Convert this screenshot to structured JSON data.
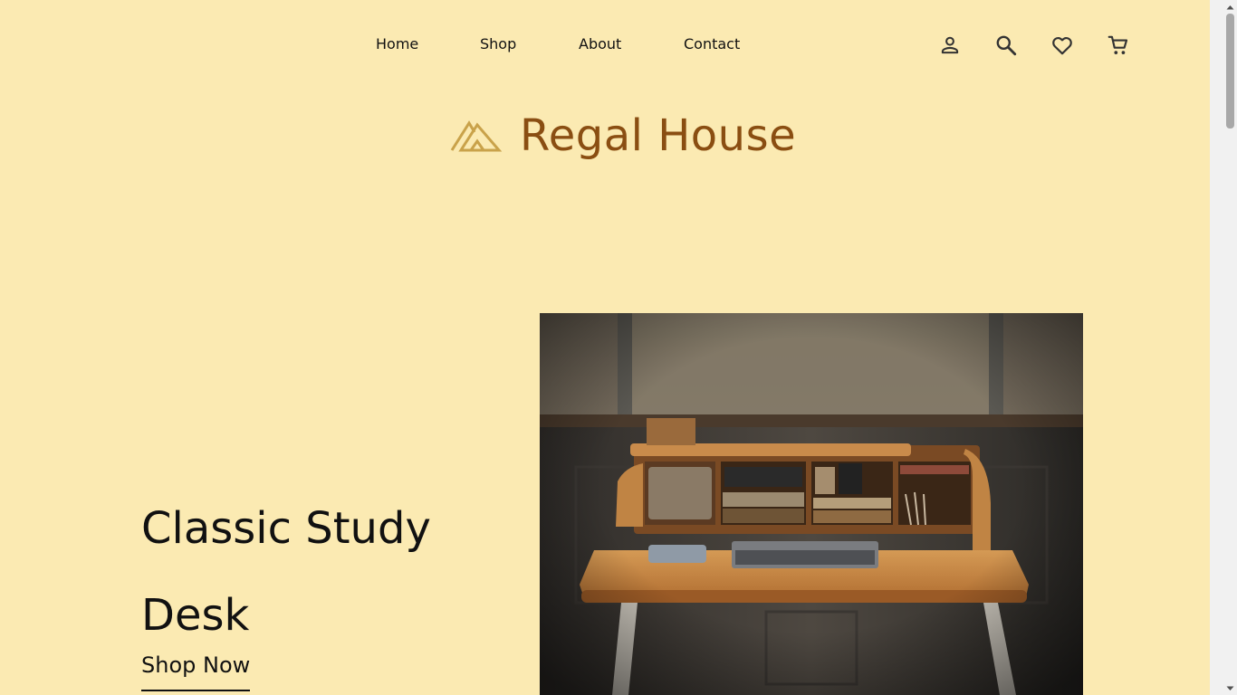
{
  "nav": {
    "items": [
      {
        "label": "Home"
      },
      {
        "label": "Shop"
      },
      {
        "label": "About"
      },
      {
        "label": "Contact"
      }
    ],
    "icons": [
      "user-icon",
      "search-icon",
      "heart-icon",
      "cart-icon"
    ]
  },
  "brand": {
    "name": "Regal House",
    "color": "#8a4e12",
    "logo_icon": "regal-house-logo-icon"
  },
  "hero": {
    "title": "Classic Study Desk",
    "cta_label": "Shop Now",
    "image_subject": "wooden study desk with laptop"
  },
  "colors": {
    "background": "#fbeab2",
    "brand": "#8a4e12",
    "logo_gold": "#c9a24a"
  }
}
